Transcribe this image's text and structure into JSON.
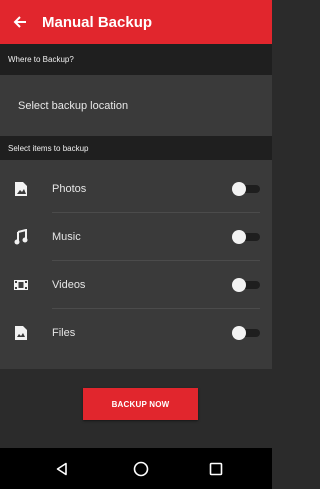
{
  "appbar": {
    "back_icon": "arrow-left-icon",
    "title": "Manual Backup"
  },
  "where_section": {
    "header": "Where to Backup?",
    "location_label": "Select backup location"
  },
  "items_section": {
    "header": "Select items to backup",
    "items": [
      {
        "label": "Photos",
        "icon": "photo-file-icon",
        "enabled": false
      },
      {
        "label": "Music",
        "icon": "music-note-icon",
        "enabled": false
      },
      {
        "label": "Videos",
        "icon": "video-film-icon",
        "enabled": false
      },
      {
        "label": "Files",
        "icon": "document-file-icon",
        "enabled": false
      }
    ]
  },
  "backup_button": {
    "label": "BACKUP NOW"
  },
  "navbar": {
    "back": "back-triangle-icon",
    "home": "home-circle-icon",
    "recents": "recents-square-icon"
  },
  "colors": {
    "accent": "#e1262d",
    "background": "#2b2b2b",
    "panel": "#3a3a3a",
    "header": "#1f1f1f"
  }
}
